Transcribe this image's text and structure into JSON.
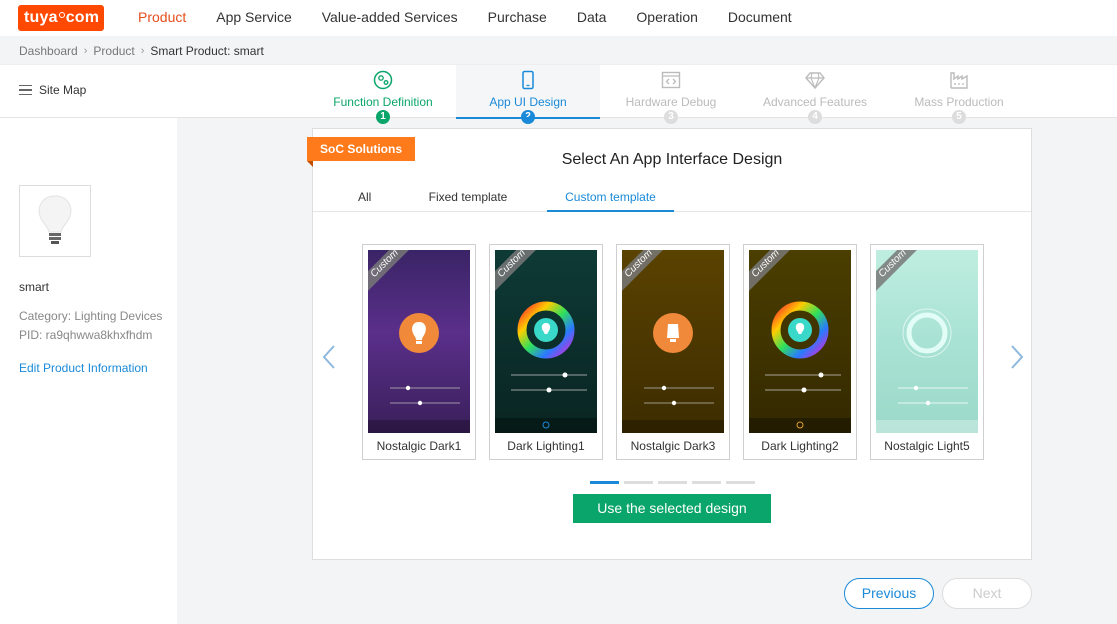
{
  "brand": {
    "logo_text_a": "tuya",
    "logo_text_b": "com",
    "color": "#ff4800"
  },
  "nav": {
    "items": [
      "Product",
      "App Service",
      "Value-added Services",
      "Purchase",
      "Data",
      "Operation",
      "Document"
    ],
    "active": "Product"
  },
  "breadcrumb": [
    "Dashboard",
    "Product",
    "Smart Product: smart"
  ],
  "sitemap": {
    "label": "Site Map",
    "icon": "menu-icon"
  },
  "steps": [
    {
      "label": "Function Definition",
      "num": "1",
      "icon": "gear-icon",
      "state": "done"
    },
    {
      "label": "App UI Design",
      "num": "2",
      "icon": "phone-icon",
      "state": "current"
    },
    {
      "label": "Hardware Debug",
      "num": "3",
      "icon": "code-icon",
      "state": "future"
    },
    {
      "label": "Advanced Features",
      "num": "4",
      "icon": "diamond-icon",
      "state": "future"
    },
    {
      "label": "Mass Production",
      "num": "5",
      "icon": "factory-icon",
      "state": "future"
    }
  ],
  "product": {
    "name": "smart",
    "category": "Category: Lighting Devices",
    "pid": "PID: ra9qhwwa8khxfhdm",
    "edit_label": "Edit Product Information",
    "image_icon": "lightbulb-icon"
  },
  "design": {
    "tag": "SoC Solutions",
    "title": "Select An App Interface Design",
    "tabs": [
      "All",
      "Fixed template",
      "Custom template"
    ],
    "active_tab": "Custom template",
    "ribbon": "Custom",
    "templates": [
      {
        "name": "Nostalgic Dark1",
        "style": "purple-bulb"
      },
      {
        "name": "Dark Lighting1",
        "style": "teal-wheel"
      },
      {
        "name": "Nostalgic Dark3",
        "style": "olive-bulb"
      },
      {
        "name": "Dark Lighting2",
        "style": "olive-wheel"
      },
      {
        "name": "Nostalgic Light5",
        "style": "mint-ring"
      }
    ],
    "pages": 5,
    "current_page": 1,
    "use_button": "Use the selected design"
  },
  "footer": {
    "previous": "Previous",
    "next": "Next"
  },
  "colors": {
    "accent": "#1a8ad8",
    "success": "#0aa56a",
    "tag": "#ff7a1a",
    "nav_active": "#e64e1c"
  }
}
